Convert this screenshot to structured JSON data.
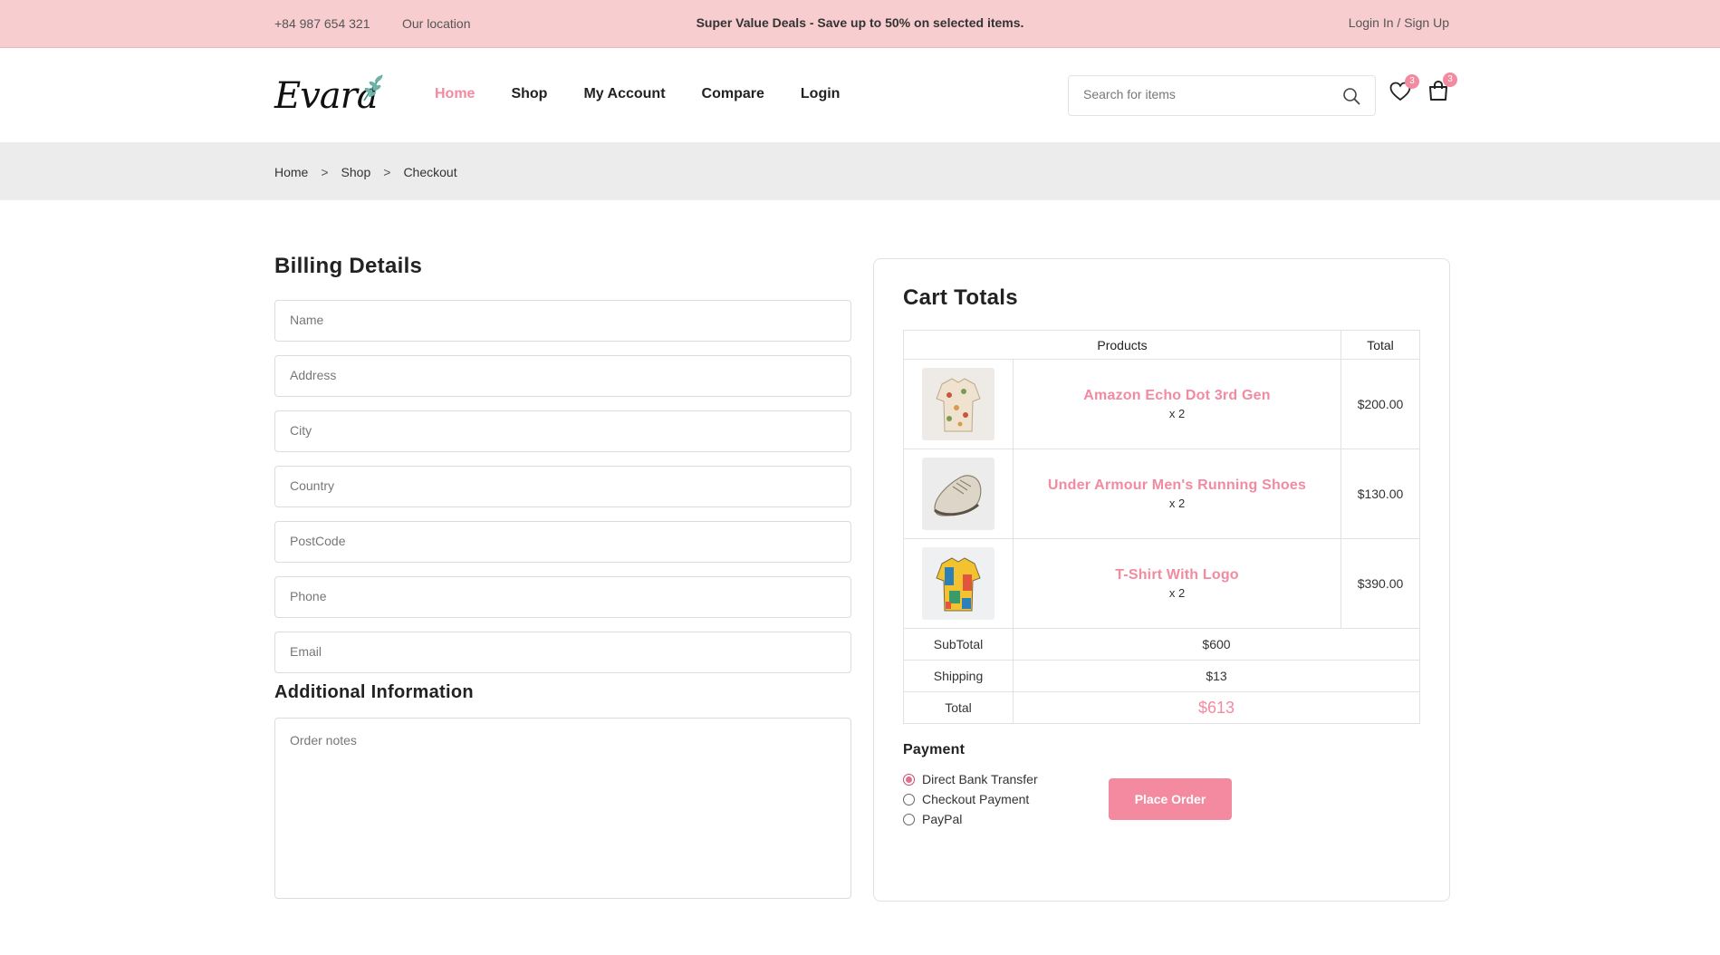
{
  "topbar": {
    "phone": "+84 987 654 321",
    "location": "Our location",
    "promo": "Super Value Deals - Save up to 50% on selected items.",
    "login": "Login In / Sign Up"
  },
  "header": {
    "logo_text": "Evara",
    "nav": [
      {
        "label": "Home",
        "active": true
      },
      {
        "label": "Shop",
        "active": false
      },
      {
        "label": "My Account",
        "active": false
      },
      {
        "label": "Compare",
        "active": false
      },
      {
        "label": "Login",
        "active": false
      }
    ],
    "search_placeholder": "Search for items",
    "wishlist_count": "3",
    "cart_count": "3",
    "icons": [
      "search-icon",
      "heart-icon",
      "shopping-bag-icon"
    ]
  },
  "breadcrumb": {
    "items": [
      "Home",
      "Shop",
      "Checkout"
    ],
    "separator": ">"
  },
  "billing": {
    "title": "Billing Details",
    "fields": [
      {
        "placeholder": "Name"
      },
      {
        "placeholder": "Address"
      },
      {
        "placeholder": "City"
      },
      {
        "placeholder": "Country"
      },
      {
        "placeholder": "PostCode"
      },
      {
        "placeholder": "Phone"
      },
      {
        "placeholder": "Email"
      }
    ],
    "additional_title": "Additional Information",
    "notes_placeholder": "Order notes"
  },
  "cart": {
    "title": "Cart Totals",
    "headers": [
      "Products",
      "Total"
    ],
    "items": [
      {
        "name": "Amazon Echo Dot 3rd Gen",
        "qty": "x 2",
        "total": "$200.00"
      },
      {
        "name": "Under Armour Men's Running Shoes",
        "qty": "x 2",
        "total": "$130.00"
      },
      {
        "name": "T-Shirt With Logo",
        "qty": "x 2",
        "total": "$390.00"
      }
    ],
    "subtotal_label": "SubTotal",
    "subtotal": "$600",
    "shipping_label": "Shipping",
    "shipping": "$13",
    "total_label": "Total",
    "total": "$613"
  },
  "payment": {
    "title": "Payment",
    "options": [
      {
        "label": "Direct Bank Transfer",
        "checked": true
      },
      {
        "label": "Checkout Payment",
        "checked": false
      },
      {
        "label": "PayPal",
        "checked": false
      }
    ],
    "place_order": "Place Order"
  },
  "colors": {
    "accent": "#f38aa0",
    "topbar_bg": "#f8cdd0",
    "crumb_bg": "#ececec"
  }
}
